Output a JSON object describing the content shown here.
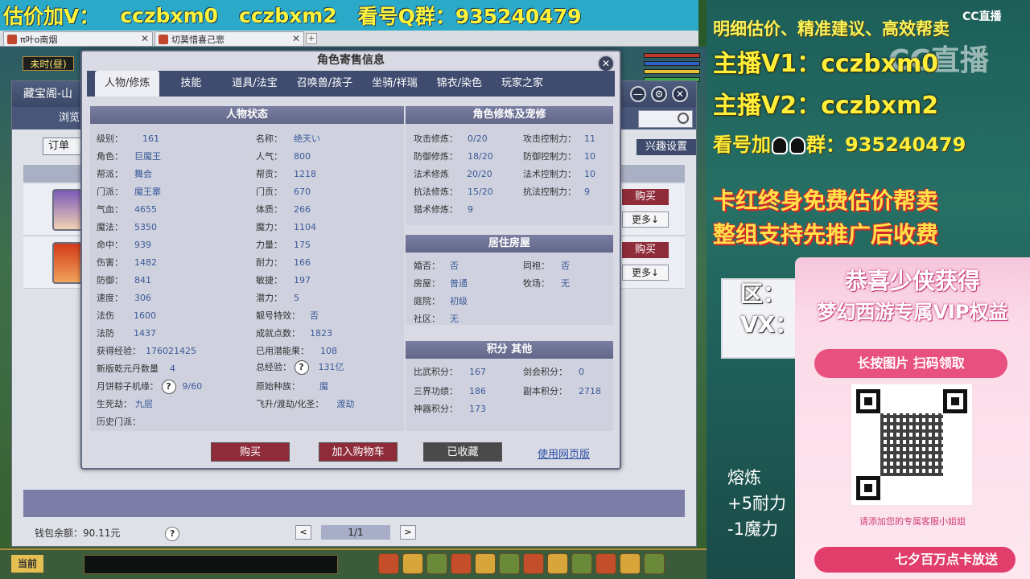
{
  "banner": {
    "segments": [
      "估价加V：",
      "cczbxm0",
      "cczbxm2",
      "看号Q群：935240479"
    ]
  },
  "tabs": [
    {
      "label": "π叶o南烟"
    },
    {
      "label": "切莫惜喜己悲"
    }
  ],
  "hud": {
    "time": "未时(昼)"
  },
  "back_window": {
    "title": "藏宝阁-山",
    "nav": "浏览",
    "order_label": "订单",
    "interest_label": "兴趣设置",
    "buy_label": "购买",
    "more_label": "更多↓",
    "wallet": "钱包余额：90.11元",
    "page": "1/1",
    "prev": "<",
    "next": ">",
    "help": "?"
  },
  "dialog": {
    "title": "角色寄售信息",
    "close": "✕",
    "tabs": [
      "人物/修炼",
      "技能",
      "道具/法宝",
      "召唤兽/孩子",
      "坐骑/祥瑞",
      "锦衣/染色",
      "玩家之家"
    ],
    "status": {
      "title": "人物状态",
      "left": [
        {
          "k": "级别：",
          "v": "161"
        },
        {
          "k": "角色：",
          "v": "巨魔王"
        },
        {
          "k": "帮派：",
          "v": "舞会"
        },
        {
          "k": "门派：",
          "v": "魔王寨"
        },
        {
          "k": "气血：",
          "v": "4655"
        },
        {
          "k": "魔法：",
          "v": "5350"
        },
        {
          "k": "命中：",
          "v": "939"
        },
        {
          "k": "伤害：",
          "v": "1482"
        },
        {
          "k": "防御：",
          "v": "841"
        },
        {
          "k": "速度：",
          "v": "306"
        },
        {
          "k": "法伤",
          "v": "1600"
        },
        {
          "k": "法防",
          "v": "1437"
        },
        {
          "k": "获得经验：",
          "v": "176021425"
        },
        {
          "k": "新版乾元丹数量",
          "v": "4"
        },
        {
          "k": "月饼粽子机缘：",
          "v": "9/60"
        },
        {
          "k": "生死劫：",
          "v": "九层"
        },
        {
          "k": "历史门派：",
          "v": ""
        }
      ],
      "right": [
        {
          "k": "名称：",
          "v": "绝天い"
        },
        {
          "k": "人气：",
          "v": "800"
        },
        {
          "k": "帮贡：",
          "v": "1218"
        },
        {
          "k": "门贡：",
          "v": "670"
        },
        {
          "k": "体质：",
          "v": "266"
        },
        {
          "k": "魔力：",
          "v": "1104"
        },
        {
          "k": "力量：",
          "v": "175"
        },
        {
          "k": "耐力：",
          "v": "166"
        },
        {
          "k": "敏捷：",
          "v": "197"
        },
        {
          "k": "潜力：",
          "v": "5"
        },
        {
          "k": "靓号特效：",
          "v": "否"
        },
        {
          "k": "成就点数：",
          "v": "1823"
        },
        {
          "k": "已用潜能果：",
          "v": "108"
        },
        {
          "k": "总经验：",
          "v": "131亿"
        },
        {
          "k": "原始种族：",
          "v": "魔"
        },
        {
          "k": "飞升/渡劫/化圣：",
          "v": "渡劫"
        }
      ]
    },
    "cultivation": {
      "title": "角色修炼及宠修",
      "left": [
        {
          "k": "攻击修炼：",
          "v": "0/20"
        },
        {
          "k": "防御修炼：",
          "v": "18/20"
        },
        {
          "k": "法术修炼",
          "v": "20/20"
        },
        {
          "k": "抗法修炼：",
          "v": "15/20"
        },
        {
          "k": "猎术修炼：",
          "v": "9"
        }
      ],
      "right": [
        {
          "k": "攻击控制力：",
          "v": "11"
        },
        {
          "k": "防御控制力：",
          "v": "10"
        },
        {
          "k": "法术控制力：",
          "v": "10"
        },
        {
          "k": "抗法控制力：",
          "v": "9"
        }
      ]
    },
    "house": {
      "title": "居住房屋",
      "left": [
        {
          "k": "婚否：",
          "v": "否"
        },
        {
          "k": "房屋：",
          "v": "普通"
        },
        {
          "k": "庭院：",
          "v": "初级"
        },
        {
          "k": "社区：",
          "v": "无"
        }
      ],
      "right": [
        {
          "k": "同袍：",
          "v": "否"
        },
        {
          "k": "牧场：",
          "v": "无"
        }
      ]
    },
    "score": {
      "title": "积分 其他",
      "left": [
        {
          "k": "比武积分：",
          "v": "167"
        },
        {
          "k": "三界功绩：",
          "v": "186"
        },
        {
          "k": "神器积分：",
          "v": "173"
        }
      ],
      "right": [
        {
          "k": "剑会积分：",
          "v": "0"
        },
        {
          "k": "副本积分：",
          "v": "2718"
        }
      ]
    },
    "buttons": {
      "buy": "购买",
      "cart": "加入购物车",
      "collected": "已收藏",
      "web": "使用网页版"
    },
    "help": "?"
  },
  "bottom": {
    "current": "当前"
  },
  "side": {
    "line1": "明细估价、精准建议、高效帮卖",
    "line2": "主播V1：cczbxm0",
    "line3": "主播V2：cczbxm2",
    "line4a": "看号加",
    "line4b": "群：935240479",
    "line5": "卡红终身免费估价帮卖",
    "line6": "整组支持先推广后收费",
    "cc_logo": "CC直播",
    "cc_watermark": "CC直播",
    "mini_a": "区：",
    "mini_b": "VX：",
    "stat1": "熔炼",
    "stat2": "+5耐力",
    "stat3": "-1魔力"
  },
  "promo": {
    "title1": "恭喜少侠获得",
    "title2": "梦幻西游专属VIP权益",
    "pill": "长按图片 扫码领取",
    "note": "请添加您的专属客服小姐姐",
    "bottom": "七夕百万点卡放送"
  },
  "colors": {
    "accent_yellow": "#ffef3a",
    "panel_header": "#626689",
    "tab_bar": "#3f4c6f",
    "buy_red": "#8f2c3a",
    "link_blue": "#2a4ea5",
    "promo_pink": "#e8507f"
  }
}
